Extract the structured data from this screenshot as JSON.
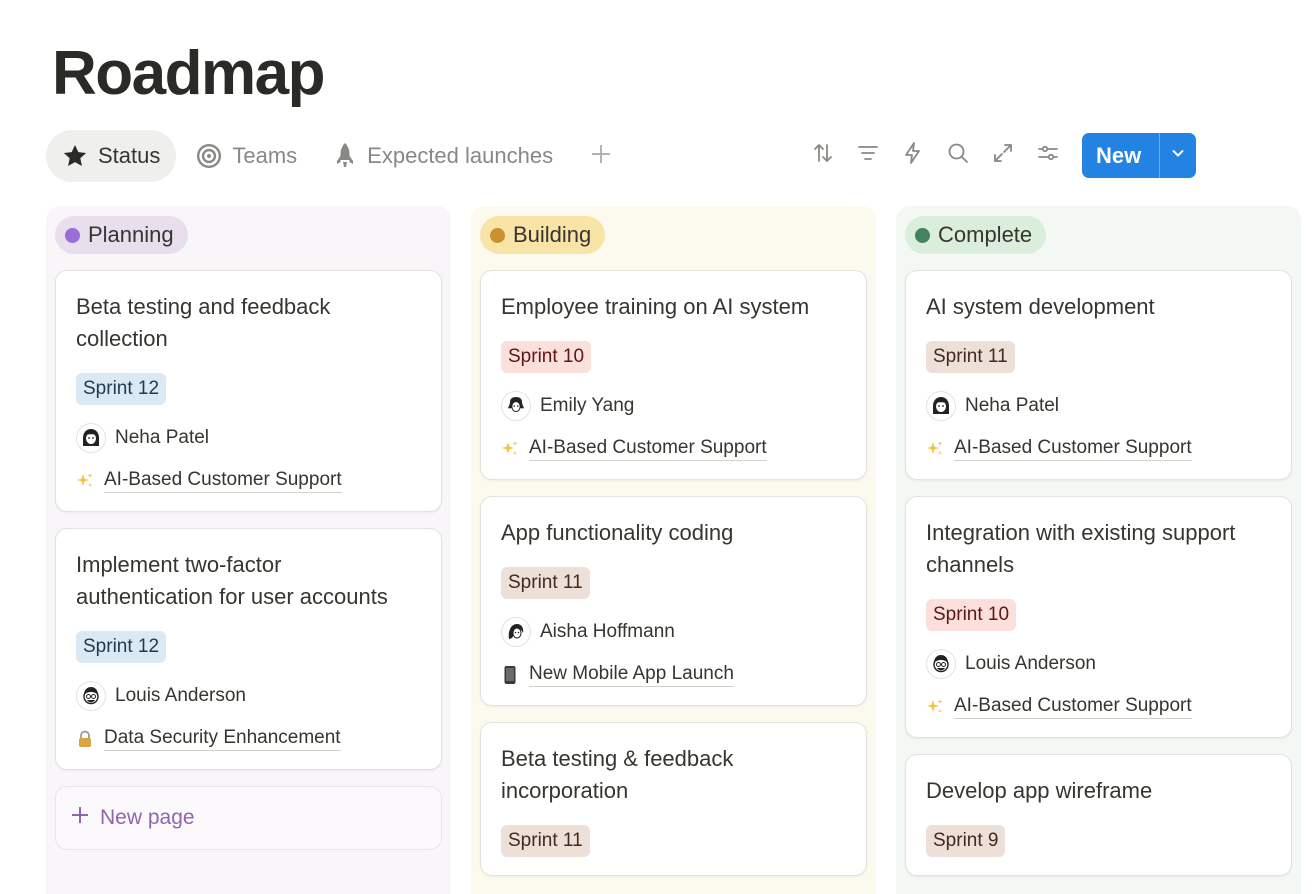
{
  "page": {
    "title": "Roadmap"
  },
  "tabs": [
    {
      "label": "Status",
      "icon": "star-icon",
      "active": true
    },
    {
      "label": "Teams",
      "icon": "target-icon",
      "active": false
    },
    {
      "label": "Expected launches",
      "icon": "rocket-icon",
      "active": false
    }
  ],
  "toolbar": {
    "icons": [
      "sort-icon",
      "filter-icon",
      "automation-icon",
      "search-icon",
      "expand-icon",
      "settings-icon"
    ],
    "new_label": "New"
  },
  "columns": [
    {
      "label": "Planning",
      "color": "#9a6dd7",
      "cards": [
        {
          "title": "Beta testing and feedback collection",
          "sprint": "Sprint 12",
          "person": "Neha Patel",
          "project_icon": "sparkles-icon",
          "project": "AI-Based Customer Support"
        },
        {
          "title": "Implement two-factor authentication for user accounts",
          "sprint": "Sprint 12",
          "person": "Louis Anderson",
          "project_icon": "lock-icon",
          "project": "Data Security Enhancement"
        }
      ],
      "new_page_label": "New page"
    },
    {
      "label": "Building",
      "color": "#cb912f",
      "cards": [
        {
          "title": "Employee training on AI system",
          "sprint": "Sprint 10",
          "person": "Emily Yang",
          "project_icon": "sparkles-icon",
          "project": "AI-Based Customer Support"
        },
        {
          "title": "App functionality coding",
          "sprint": "Sprint 11",
          "person": "Aisha Hoffmann",
          "project_icon": "phone-icon",
          "project": "New Mobile App Launch"
        },
        {
          "title": "Beta testing & feedback incorporation",
          "sprint": "Sprint 11"
        }
      ]
    },
    {
      "label": "Complete",
      "color": "#448361",
      "cards": [
        {
          "title": "AI system development",
          "sprint": "Sprint 11",
          "person": "Neha Patel",
          "project_icon": "sparkles-icon",
          "project": "AI-Based Customer Support"
        },
        {
          "title": "Integration with existing support channels",
          "sprint": "Sprint 10",
          "person": "Louis Anderson",
          "project_icon": "sparkles-icon",
          "project": "AI-Based Customer Support"
        },
        {
          "title": "Develop app wireframe",
          "sprint": "Sprint 9"
        }
      ]
    }
  ]
}
